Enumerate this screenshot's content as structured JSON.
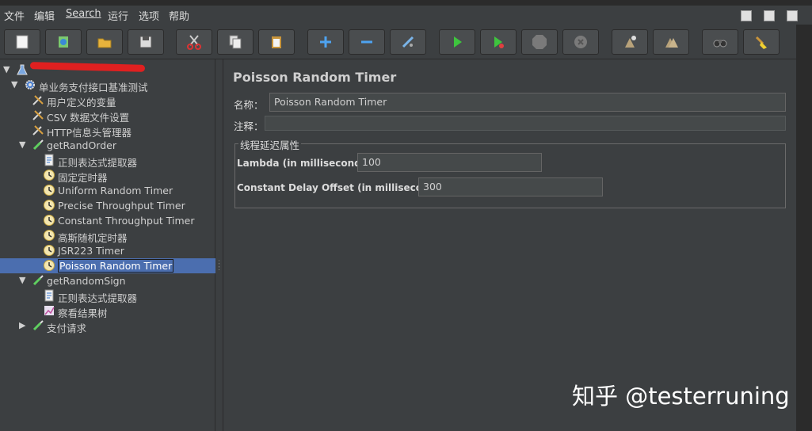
{
  "menu": [
    "文件",
    "编辑",
    "Search",
    "运行",
    "选项",
    "帮助"
  ],
  "toolbar_icons": [
    "new-icon",
    "templates-icon",
    "open-icon",
    "save-icon",
    "cut-icon",
    "copy-icon",
    "paste-icon",
    "expand-icon",
    "collapse-icon",
    "toggle-icon",
    "start-icon",
    "start-no-pause-icon",
    "stop-icon",
    "shutdown-icon",
    "clear-icon",
    "clear-all-icon",
    "search-icon",
    "reset-search-icon"
  ],
  "tree": [
    {
      "label": "",
      "indent": 0,
      "arrow": "▼",
      "icon": "flask-icon"
    },
    {
      "label": "单业务支付接口基准测试",
      "indent": 1,
      "arrow": "▼",
      "icon": "gear-icon"
    },
    {
      "label": "用户定义的变量",
      "indent": 2,
      "arrow": "",
      "icon": "wrench-icon"
    },
    {
      "label": "CSV 数据文件设置",
      "indent": 2,
      "arrow": "",
      "icon": "wrench-icon"
    },
    {
      "label": "HTTP信息头管理器",
      "indent": 2,
      "arrow": "",
      "icon": "wrench-icon"
    },
    {
      "label": "getRandOrder",
      "indent": 2,
      "arrow": "▼",
      "icon": "pipette-icon"
    },
    {
      "label": "正则表达式提取器",
      "indent": 3,
      "arrow": "",
      "icon": "document-icon"
    },
    {
      "label": "固定定时器",
      "indent": 3,
      "arrow": "",
      "icon": "clock-icon"
    },
    {
      "label": "Uniform Random Timer",
      "indent": 3,
      "arrow": "",
      "icon": "clock-icon"
    },
    {
      "label": "Precise Throughput Timer",
      "indent": 3,
      "arrow": "",
      "icon": "clock-icon"
    },
    {
      "label": "Constant Throughput Timer",
      "indent": 3,
      "arrow": "",
      "icon": "clock-icon"
    },
    {
      "label": "高斯随机定时器",
      "indent": 3,
      "arrow": "",
      "icon": "clock-icon"
    },
    {
      "label": "JSR223 Timer",
      "indent": 3,
      "arrow": "",
      "icon": "clock-icon"
    },
    {
      "label": "Poisson Random Timer",
      "indent": 3,
      "arrow": "",
      "icon": "clock-icon",
      "selected": true
    },
    {
      "label": "getRandomSign",
      "indent": 2,
      "arrow": "▼",
      "icon": "pipette-icon"
    },
    {
      "label": "正则表达式提取器",
      "indent": 3,
      "arrow": "",
      "icon": "document-icon"
    },
    {
      "label": "察看结果树",
      "indent": 3,
      "arrow": "",
      "icon": "chart-icon"
    },
    {
      "label": "支付请求",
      "indent": 2,
      "arrow": "▶",
      "icon": "pipette-icon"
    }
  ],
  "panel": {
    "title": "Poisson Random Timer",
    "name_label": "名称：",
    "name_value": "Poisson Random Timer",
    "comment_label": "注释：",
    "comment_value": "",
    "group_title": "线程延迟属性",
    "lambda_label": "Lambda (in milliseconds):",
    "lambda_value": "100",
    "offset_label": "Constant Delay Offset (in milliseconds):",
    "offset_value": "300"
  },
  "watermark": "知乎 @testerruning",
  "colors": {
    "background": "#3c3f41",
    "selection": "#4b6eaf",
    "redaction": "#e02020"
  }
}
